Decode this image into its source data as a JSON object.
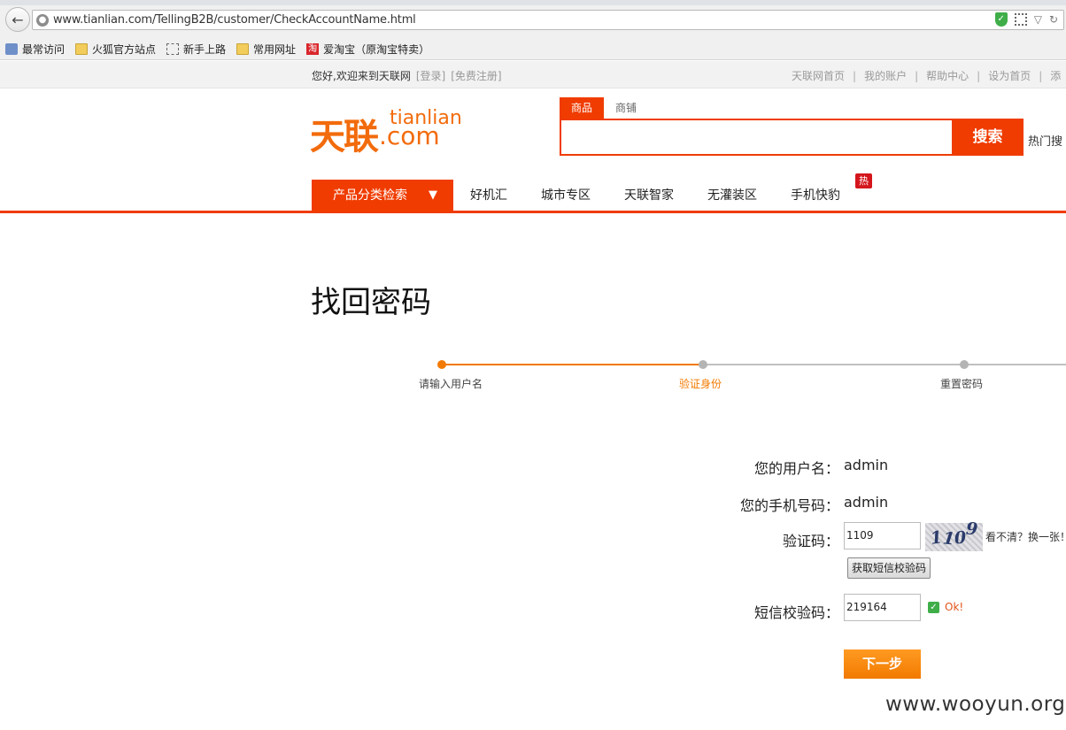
{
  "browser": {
    "url": "www.tianlian.com/TellingB2B/customer/CheckAccountName.html",
    "bookmarks": [
      "最常访问",
      "火狐官方站点",
      "新手上路",
      "常用网址",
      "爱淘宝（原淘宝特卖）"
    ]
  },
  "topbar": {
    "welcome": "您好,欢迎来到天联网",
    "login": "[登录]",
    "register": "[免费注册]",
    "links": [
      "天联网首页",
      "我的账户",
      "帮助中心",
      "设为首页",
      "添"
    ]
  },
  "header": {
    "logo_cn": "天联",
    "logo_en_top": "tianlian",
    "logo_en_bottom": ".com",
    "search_tabs": [
      "商品",
      "商铺"
    ],
    "search_button": "搜索",
    "hot_search": "热门搜"
  },
  "nav": {
    "category": "产品分类检索",
    "items": [
      "好机汇",
      "城市专区",
      "天联智家",
      "无灌装区",
      "手机快豹"
    ],
    "hot_badge": "热"
  },
  "page": {
    "title": "找回密码",
    "steps": [
      {
        "label": "请输入用户名",
        "state": "done"
      },
      {
        "label": "验证身份",
        "state": "active"
      },
      {
        "label": "重置密码",
        "state": "todo"
      }
    ],
    "colors": {
      "accent": "#f03c00",
      "progress_active": "#f27a00",
      "progress_todo": "#c0c0c0"
    }
  },
  "form": {
    "username_label": "您的用户名：",
    "username_value": "admin",
    "phone_label": "您的手机号码：",
    "phone_value": "admin",
    "captcha_label": "验证码：",
    "captcha_input": "1109",
    "captcha_digits": [
      "1",
      "1",
      "0",
      "9"
    ],
    "captcha_refresh": "看不清？换一张！",
    "sms_button": "获取短信校验码",
    "sms_label": "短信校验码：",
    "sms_input": "219164",
    "ok_text": "Ok!",
    "next_button": "下一步"
  },
  "watermark": "www.wooyun.org"
}
